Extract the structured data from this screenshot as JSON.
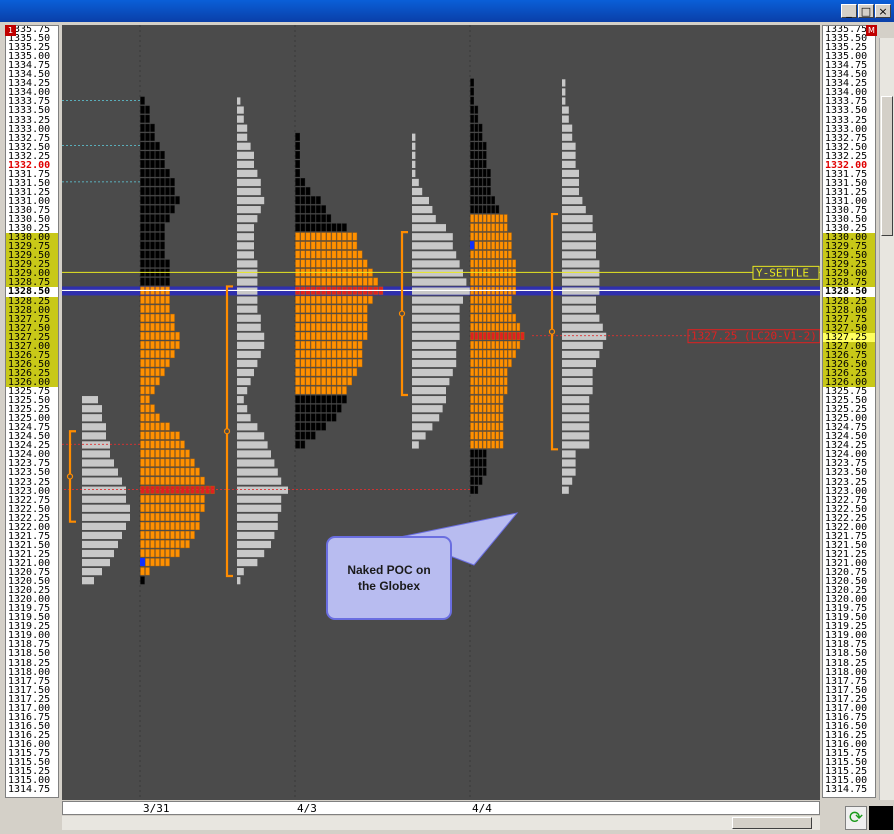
{
  "window": {
    "controls": [
      "_",
      "□",
      "×"
    ],
    "left_badge": "1",
    "right_badge": "M"
  },
  "chart_data": {
    "type": "market-profile",
    "price_axis": {
      "max": 1335.75,
      "min": 1314.75,
      "tick": 0.25,
      "highlight_range": [
        1326.0,
        1330.0
      ],
      "red_labels": [
        1332.0
      ],
      "current_price": 1328.5,
      "right_marker": 1327.25
    },
    "dates": [
      "3/31",
      "4/3",
      "4/4"
    ],
    "sessions": [
      {
        "name": "globex-3/31",
        "value_area": [
          1322.25,
          1324.5
        ],
        "poc": 1324.25,
        "histogram": [
          [
            1325.5,
            4
          ],
          [
            1325.25,
            5
          ],
          [
            1325.0,
            5
          ],
          [
            1324.75,
            6
          ],
          [
            1324.5,
            6
          ],
          [
            1324.25,
            7
          ],
          [
            1324.0,
            7
          ],
          [
            1323.75,
            8
          ],
          [
            1323.5,
            9
          ],
          [
            1323.25,
            10
          ],
          [
            1323.0,
            11
          ],
          [
            1322.75,
            11
          ],
          [
            1322.5,
            12
          ],
          [
            1322.25,
            12
          ],
          [
            1322.0,
            11
          ],
          [
            1321.75,
            10
          ],
          [
            1321.5,
            9
          ],
          [
            1321.25,
            8
          ],
          [
            1321.0,
            7
          ],
          [
            1320.75,
            5
          ],
          [
            1320.5,
            3
          ]
        ]
      },
      {
        "name": "rth-3/31",
        "value_area": [
          1320.75,
          1328.5
        ],
        "poc": 1323.0,
        "open_marker": 1321.0,
        "histogram": [
          [
            1333.75,
            1
          ],
          [
            1333.5,
            2
          ],
          [
            1333.25,
            2
          ],
          [
            1333.0,
            3
          ],
          [
            1332.75,
            3
          ],
          [
            1332.5,
            4
          ],
          [
            1332.25,
            5
          ],
          [
            1332.0,
            5
          ],
          [
            1331.75,
            6
          ],
          [
            1331.5,
            7
          ],
          [
            1331.25,
            7
          ],
          [
            1331.0,
            8
          ],
          [
            1330.75,
            7
          ],
          [
            1330.5,
            6
          ],
          [
            1330.25,
            5
          ],
          [
            1330.0,
            5
          ],
          [
            1329.75,
            5
          ],
          [
            1329.5,
            5
          ],
          [
            1329.25,
            6
          ],
          [
            1329.0,
            6
          ],
          [
            1328.75,
            6
          ],
          [
            1328.5,
            6
          ],
          [
            1328.25,
            6
          ],
          [
            1328.0,
            6
          ],
          [
            1327.75,
            7
          ],
          [
            1327.5,
            7
          ],
          [
            1327.25,
            8
          ],
          [
            1327.0,
            8
          ],
          [
            1326.75,
            7
          ],
          [
            1326.5,
            6
          ],
          [
            1326.25,
            5
          ],
          [
            1326.0,
            4
          ],
          [
            1325.75,
            3
          ],
          [
            1325.5,
            2
          ],
          [
            1325.25,
            3
          ],
          [
            1325.0,
            4
          ],
          [
            1324.75,
            6
          ],
          [
            1324.5,
            8
          ],
          [
            1324.25,
            9
          ],
          [
            1324.0,
            10
          ],
          [
            1323.75,
            11
          ],
          [
            1323.5,
            12
          ],
          [
            1323.25,
            13
          ],
          [
            1323.0,
            15
          ],
          [
            1322.75,
            13
          ],
          [
            1322.5,
            13
          ],
          [
            1322.25,
            12
          ],
          [
            1322.0,
            12
          ],
          [
            1321.75,
            11
          ],
          [
            1321.5,
            10
          ],
          [
            1321.25,
            8
          ],
          [
            1321.0,
            6
          ],
          [
            1320.75,
            2
          ],
          [
            1320.5,
            1
          ]
        ]
      },
      {
        "name": "rth-4/3",
        "value_area": [
          1325.75,
          1330.0
        ],
        "poc": 1328.5,
        "histogram": [
          [
            1332.75,
            1
          ],
          [
            1332.5,
            1
          ],
          [
            1332.25,
            1
          ],
          [
            1332.0,
            1
          ],
          [
            1331.75,
            1
          ],
          [
            1331.5,
            2
          ],
          [
            1331.25,
            3
          ],
          [
            1331.0,
            5
          ],
          [
            1330.75,
            6
          ],
          [
            1330.5,
            7
          ],
          [
            1330.25,
            10
          ],
          [
            1330.0,
            12
          ],
          [
            1329.75,
            12
          ],
          [
            1329.5,
            13
          ],
          [
            1329.25,
            14
          ],
          [
            1329.0,
            15
          ],
          [
            1328.75,
            16
          ],
          [
            1328.5,
            17
          ],
          [
            1328.25,
            15
          ],
          [
            1328.0,
            14
          ],
          [
            1327.75,
            14
          ],
          [
            1327.5,
            14
          ],
          [
            1327.25,
            14
          ],
          [
            1327.0,
            13
          ],
          [
            1326.75,
            13
          ],
          [
            1326.5,
            13
          ],
          [
            1326.25,
            12
          ],
          [
            1326.0,
            11
          ],
          [
            1325.75,
            10
          ],
          [
            1325.5,
            10
          ],
          [
            1325.25,
            9
          ],
          [
            1325.0,
            8
          ],
          [
            1324.75,
            6
          ],
          [
            1324.5,
            4
          ],
          [
            1324.25,
            2
          ]
        ]
      },
      {
        "name": "rth-4/4",
        "value_area": [
          1324.25,
          1330.5
        ],
        "poc": 1327.25,
        "open_marker": 1329.75,
        "histogram": [
          [
            1334.25,
            1
          ],
          [
            1334.0,
            1
          ],
          [
            1333.75,
            1
          ],
          [
            1333.5,
            2
          ],
          [
            1333.25,
            2
          ],
          [
            1333.0,
            3
          ],
          [
            1332.75,
            3
          ],
          [
            1332.5,
            4
          ],
          [
            1332.25,
            4
          ],
          [
            1332.0,
            4
          ],
          [
            1331.75,
            5
          ],
          [
            1331.5,
            5
          ],
          [
            1331.25,
            5
          ],
          [
            1331.0,
            6
          ],
          [
            1330.75,
            7
          ],
          [
            1330.5,
            9
          ],
          [
            1330.25,
            9
          ],
          [
            1330.0,
            10
          ],
          [
            1329.75,
            10
          ],
          [
            1329.5,
            10
          ],
          [
            1329.25,
            11
          ],
          [
            1329.0,
            11
          ],
          [
            1328.75,
            11
          ],
          [
            1328.5,
            11
          ],
          [
            1328.25,
            10
          ],
          [
            1328.0,
            10
          ],
          [
            1327.75,
            11
          ],
          [
            1327.5,
            12
          ],
          [
            1327.25,
            13
          ],
          [
            1327.0,
            12
          ],
          [
            1326.75,
            11
          ],
          [
            1326.5,
            10
          ],
          [
            1326.25,
            9
          ],
          [
            1326.0,
            9
          ],
          [
            1325.75,
            9
          ],
          [
            1325.5,
            8
          ],
          [
            1325.25,
            8
          ],
          [
            1325.0,
            8
          ],
          [
            1324.75,
            8
          ],
          [
            1324.5,
            8
          ],
          [
            1324.25,
            8
          ],
          [
            1324.0,
            4
          ],
          [
            1323.75,
            4
          ],
          [
            1323.5,
            4
          ],
          [
            1323.25,
            3
          ],
          [
            1323.0,
            2
          ]
        ]
      }
    ],
    "lines": {
      "y_settle": 1329.0,
      "current": 1328.5,
      "naked_poc": 1323.0
    },
    "y_settle_label": "Y-SETTLE",
    "right_tag_label": "1327.25 (LC20-V1-2)",
    "annotation": [
      "Naked POC on",
      "the Globex"
    ]
  }
}
